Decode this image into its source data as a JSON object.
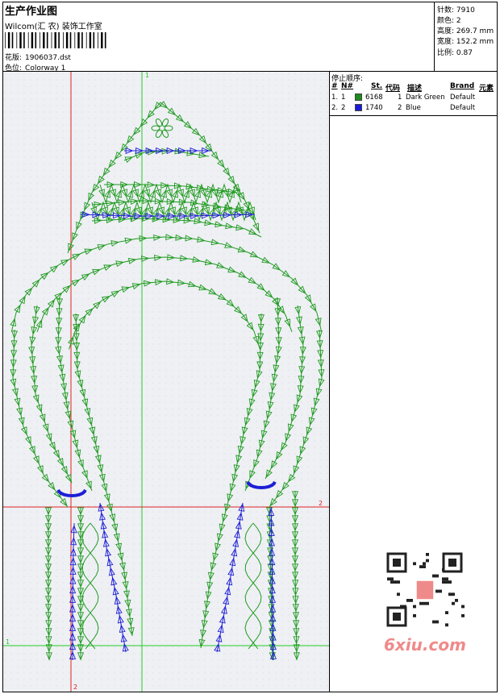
{
  "header": {
    "title": "生产作业图",
    "company": "Wilcom(汇 农) 装饰工作室",
    "design": {
      "label": "花版:",
      "value": "1906037.dst"
    },
    "colorway": {
      "label": "色位:",
      "value": "Colorway 1"
    }
  },
  "stats": {
    "stitches": {
      "label": "针数:",
      "value": "7910"
    },
    "colors": {
      "label": "颜色:",
      "value": "2"
    },
    "height": {
      "label": "高度:",
      "value": "269.7 mm"
    },
    "width": {
      "label": "宽度:",
      "value": "152.2 mm"
    },
    "scale": {
      "label": "比例:",
      "value": "0.87"
    }
  },
  "stop_sequence": {
    "title": "停止顺序:",
    "headers": {
      "hash": "#",
      "n": "N#",
      "st": "St.",
      "code": "代码",
      "desc": "描述",
      "brand": "Brand",
      "elem": "元素"
    },
    "rows": [
      {
        "hash": "1.",
        "n": "1",
        "color": "#1a8c1a",
        "st": "6168",
        "code": "1",
        "desc": "Dark Green",
        "brand": "Default"
      },
      {
        "hash": "2.",
        "n": "2",
        "color": "#1a1adc",
        "st": "1740",
        "code": "2",
        "desc": "Blue",
        "brand": "Default"
      }
    ]
  },
  "guides": {
    "label_1": "1",
    "label_2": "2",
    "color_green": "#22cc22",
    "color_red": "#dd2222"
  },
  "thread_colors": {
    "green": "#1f9a1f",
    "blue": "#1e1ed6"
  },
  "watermark": {
    "text": "6xiu.com",
    "color": "#ef8a8a"
  }
}
